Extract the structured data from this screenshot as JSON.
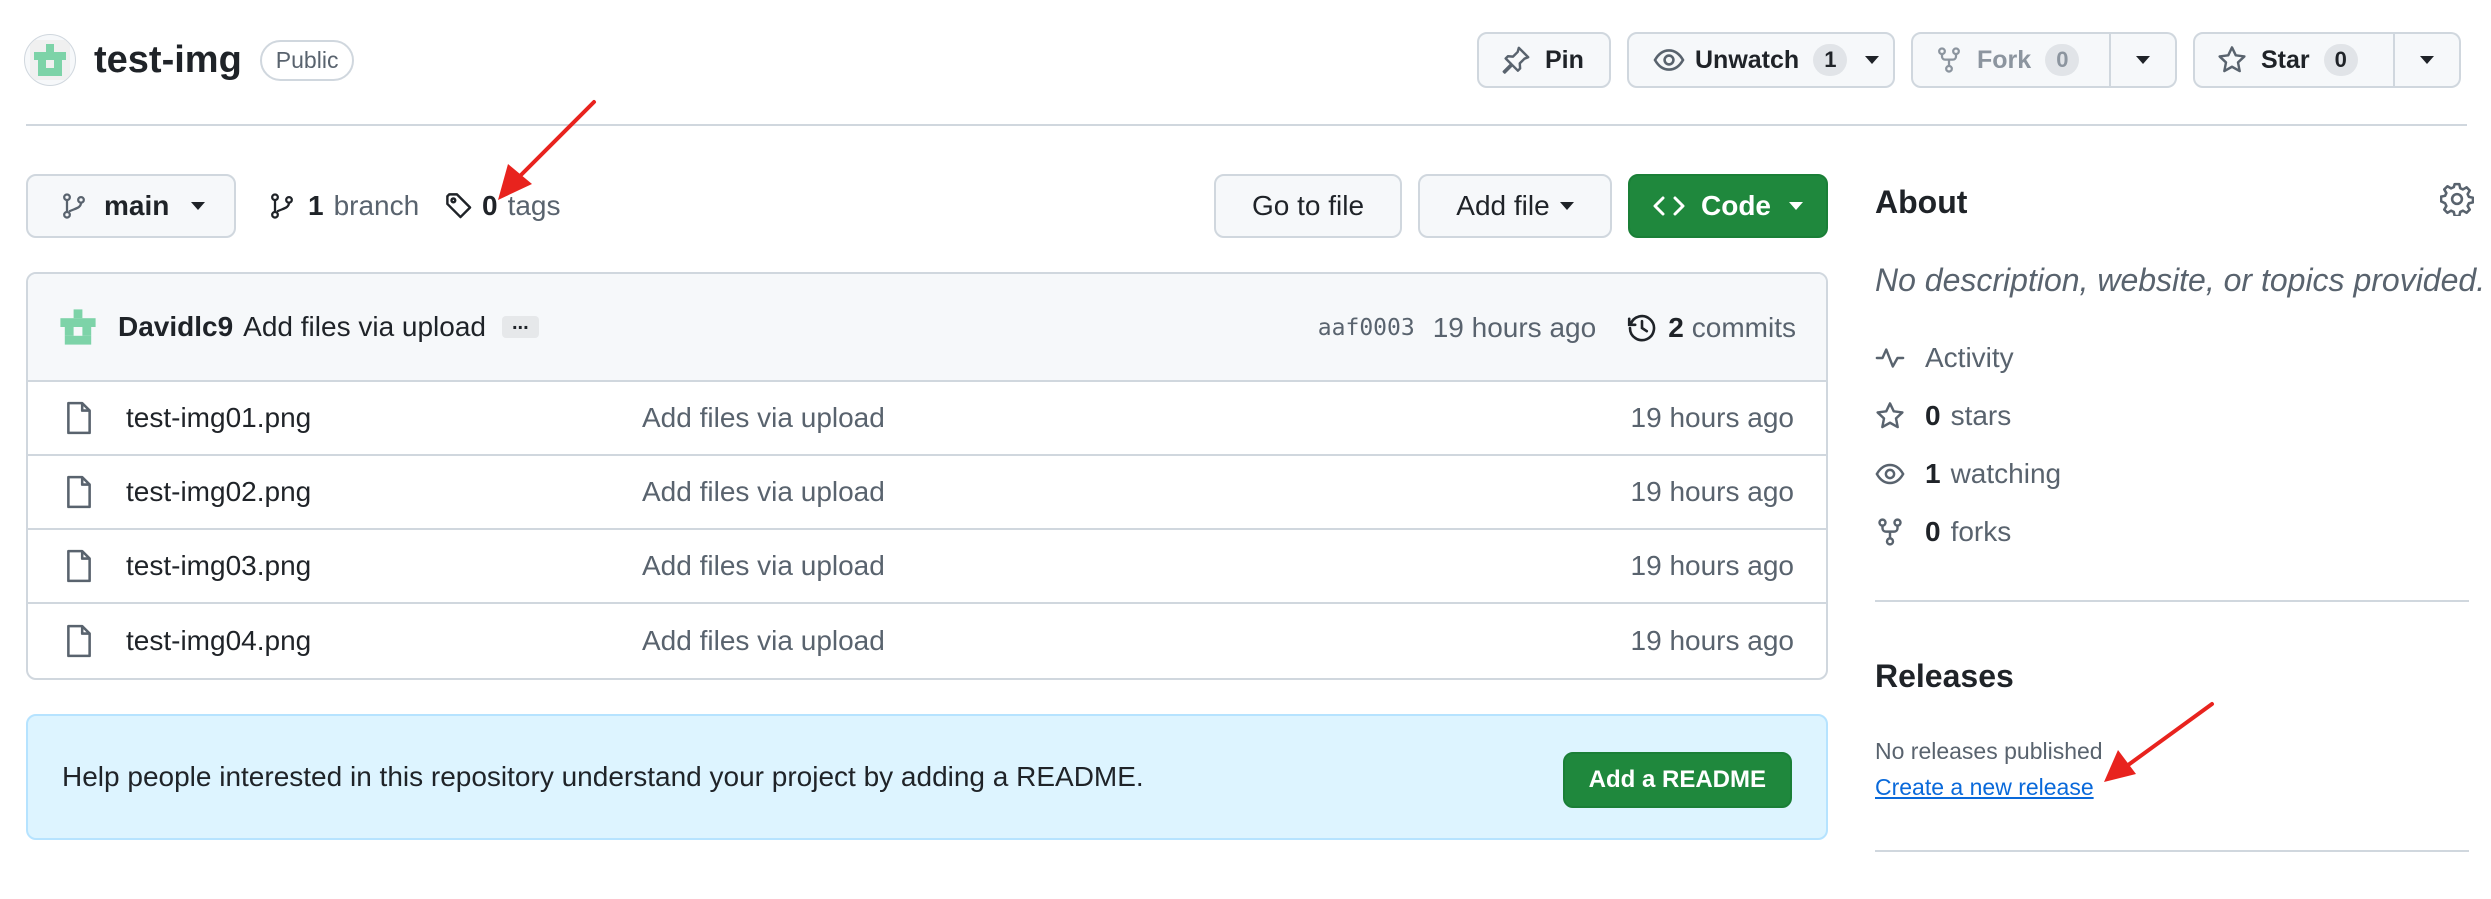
{
  "repo": {
    "name": "test-img",
    "visibility": "Public"
  },
  "header_actions": {
    "pin": "Pin",
    "unwatch": "Unwatch",
    "unwatch_count": "1",
    "fork": "Fork",
    "fork_count": "0",
    "star": "Star",
    "star_count": "0"
  },
  "branch_bar": {
    "branch_name": "main",
    "branch_count": "1",
    "branch_label": "branch",
    "tag_count": "0",
    "tag_label": "tags",
    "go_to_file": "Go to file",
    "add_file": "Add file",
    "code": "Code"
  },
  "latest_commit": {
    "author": "Davidlc9",
    "message": "Add files via upload",
    "ellipsis": "...",
    "sha": "aaf0003",
    "time": "19 hours ago",
    "commit_count": "2",
    "commit_label": "commits"
  },
  "files": [
    {
      "name": "test-img01.png",
      "message": "Add files via upload",
      "time": "19 hours ago"
    },
    {
      "name": "test-img02.png",
      "message": "Add files via upload",
      "time": "19 hours ago"
    },
    {
      "name": "test-img03.png",
      "message": "Add files via upload",
      "time": "19 hours ago"
    },
    {
      "name": "test-img04.png",
      "message": "Add files via upload",
      "time": "19 hours ago"
    }
  ],
  "readme_banner": {
    "text": "Help people interested in this repository understand your project by adding a README.",
    "button": "Add a README"
  },
  "about": {
    "title": "About",
    "description": "No description, website, or topics provided.",
    "activity": "Activity",
    "stars_count": "0",
    "stars_label": "stars",
    "watching_count": "1",
    "watching_label": "watching",
    "forks_count": "0",
    "forks_label": "forks"
  },
  "releases": {
    "title": "Releases",
    "none": "No releases published",
    "create_link": "Create a new release"
  },
  "colors": {
    "primary_green": "#1f883d",
    "link_blue": "#0969da",
    "annotation_red": "#e8231e",
    "banner_bg": "#ddf4ff"
  },
  "icons": [
    "repo-avatar-icon",
    "pin-icon",
    "eye-icon",
    "fork-icon",
    "star-icon",
    "git-branch-icon",
    "tag-icon",
    "code-icon",
    "history-icon",
    "file-icon",
    "gear-icon",
    "pulse-icon"
  ]
}
